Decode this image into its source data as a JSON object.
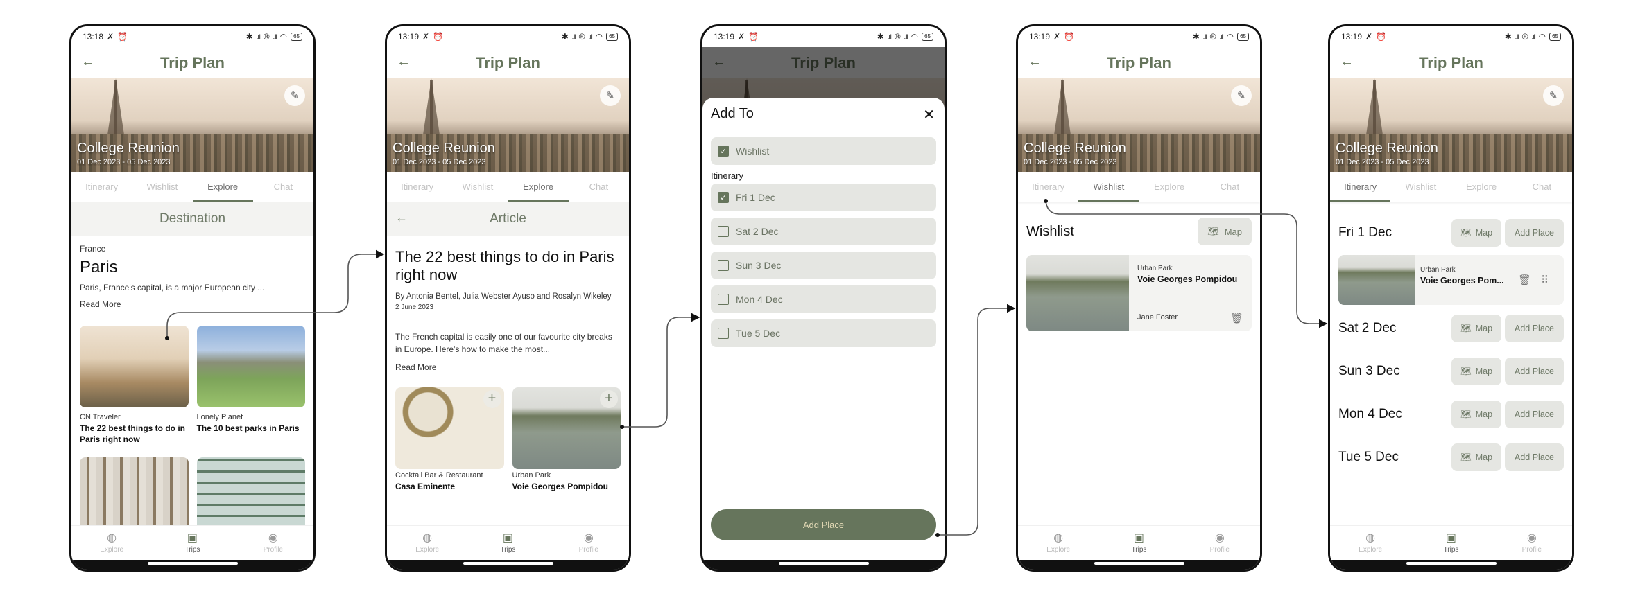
{
  "colors": {
    "accent": "#66755c",
    "chip_bg": "#e5e6e2",
    "card_bg": "#f3f3f1",
    "button_text": "#e6dcb8"
  },
  "common": {
    "app_title": "Trip Plan",
    "trip_name": "College Reunion",
    "trip_dates": "01 Dec 2023 - 05 Dec 2023",
    "tabs": [
      "Itinerary",
      "Wishlist",
      "Explore",
      "Chat"
    ],
    "nav": [
      {
        "label": "Explore",
        "icon": "globe-icon"
      },
      {
        "label": "Trips",
        "icon": "calendar-icon"
      },
      {
        "label": "Profile",
        "icon": "profile-icon"
      }
    ],
    "status": {
      "battery": "65",
      "icons": [
        "bluetooth-icon",
        "signal-icon",
        "roaming-icon",
        "signal-icon",
        "wifi-icon",
        "battery-icon"
      ]
    }
  },
  "screens": [
    {
      "time": "13:18",
      "active_tab": "Explore",
      "subheader": "Destination",
      "country": "France",
      "city": "Paris",
      "description": "Paris, France's capital, is a major European city ...",
      "read_more": "Read More",
      "cards": [
        {
          "source": "CN Traveler",
          "title": "The 22 best things to do in Paris right now"
        },
        {
          "source": "Lonely Planet",
          "title": "The 10 best parks in Paris"
        },
        {
          "source": "",
          "title": ""
        },
        {
          "source": "",
          "title": ""
        }
      ]
    },
    {
      "time": "13:19",
      "active_tab": "Explore",
      "subheader": "Article",
      "title": "The 22 best things to do in Paris right now",
      "byline": "By Antonia Bentel, Julia Webster Ayuso and Rosalyn Wikeley",
      "date": "2 June 2023",
      "body": "The French capital is easily one of our favourite city breaks in Europe. Here's how to make the most...",
      "read_more": "Read More",
      "places": [
        {
          "type": "Cocktail Bar & Restaurant",
          "name": "Casa Eminente"
        },
        {
          "type": "Urban Park",
          "name": "Voie Georges Pompidou"
        }
      ]
    },
    {
      "time": "13:19",
      "sheet_title": "Add To",
      "wishlist_option": {
        "label": "Wishlist",
        "checked": true
      },
      "itinerary_label": "Itinerary",
      "days": [
        {
          "label": "Fri 1 Dec",
          "checked": true
        },
        {
          "label": "Sat 2 Dec",
          "checked": false
        },
        {
          "label": "Sun 3 Dec",
          "checked": false
        },
        {
          "label": "Mon 4 Dec",
          "checked": false
        },
        {
          "label": "Tue 5 Dec",
          "checked": false
        }
      ],
      "button": "Add Place"
    },
    {
      "time": "13:19",
      "active_tab": "Wishlist",
      "heading": "Wishlist",
      "map_label": "Map",
      "item": {
        "type": "Urban Park",
        "name": "Voie Georges Pompidou",
        "added_by": "Jane Foster"
      }
    },
    {
      "time": "13:19",
      "active_tab": "Itinerary",
      "map_label": "Map",
      "add_label": "Add Place",
      "days": [
        "Fri 1 Dec",
        "Sat 2 Dec",
        "Sun 3 Dec",
        "Mon 4 Dec",
        "Tue 5 Dec"
      ],
      "day1_item": {
        "type": "Urban Park",
        "name": "Voie Georges Pom..."
      }
    }
  ]
}
